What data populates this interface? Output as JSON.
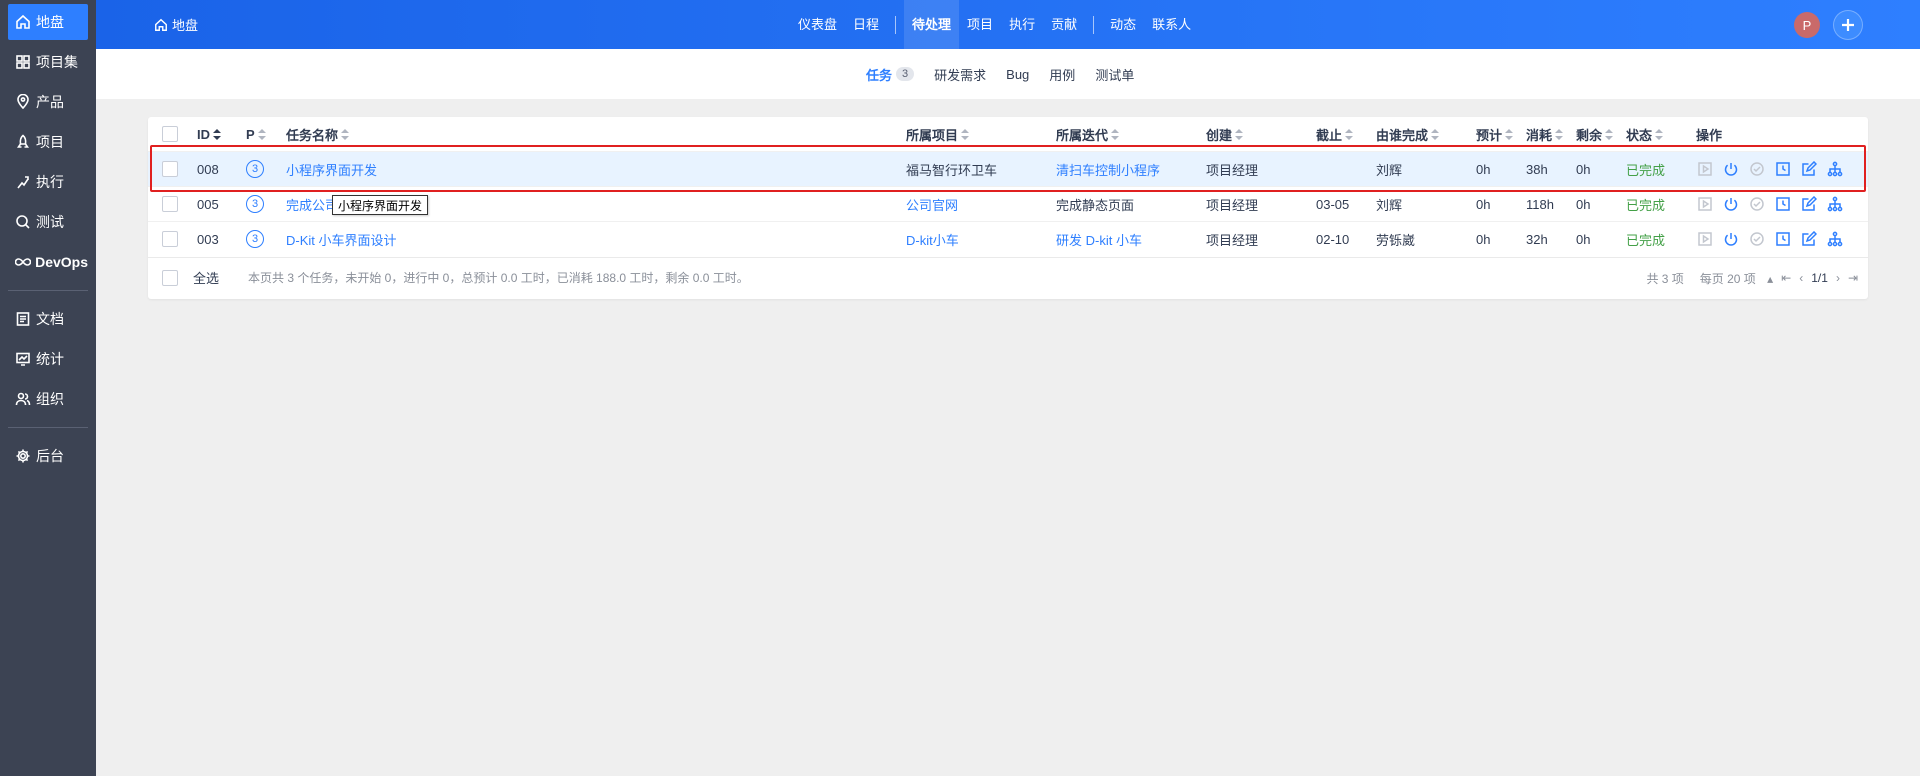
{
  "sidebar": {
    "items": [
      {
        "label": "地盘",
        "icon": "home-icon",
        "active": true
      },
      {
        "label": "项目集",
        "icon": "grid-icon"
      },
      {
        "label": "产品",
        "icon": "map-pin-icon"
      },
      {
        "label": "项目",
        "icon": "rocket-icon"
      },
      {
        "label": "执行",
        "icon": "run-icon"
      },
      {
        "label": "测试",
        "icon": "search-icon"
      },
      {
        "label": "DevOps",
        "icon": "infinity-icon"
      },
      {
        "label": "文档",
        "icon": "document-icon"
      },
      {
        "label": "统计",
        "icon": "chart-icon"
      },
      {
        "label": "组织",
        "icon": "people-icon"
      },
      {
        "label": "后台",
        "icon": "gear-icon"
      }
    ]
  },
  "header": {
    "brand": "地盘",
    "nav": [
      "仪表盘",
      "日程",
      "待处理",
      "项目",
      "执行",
      "贡献",
      "动态",
      "联系人"
    ],
    "avatar": "P"
  },
  "subnav": {
    "tabs": [
      {
        "label": "任务",
        "badge": "3",
        "active": true
      },
      {
        "label": "研发需求"
      },
      {
        "label": "Bug"
      },
      {
        "label": "用例"
      },
      {
        "label": "测试单"
      }
    ]
  },
  "table": {
    "headers": {
      "id": "ID",
      "pri": "P",
      "name": "任务名称",
      "project": "所属项目",
      "execution": "所属迭代",
      "creator": "创建",
      "deadline": "截止",
      "finishedBy": "由谁完成",
      "estimate": "预计",
      "consumed": "消耗",
      "left": "剩余",
      "status": "状态",
      "actions": "操作"
    },
    "rows": [
      {
        "id": "008",
        "pri": "3",
        "name": "小程序界面开发",
        "project": "福马智行环卫车",
        "execution": "清扫车控制小程序",
        "creator": "项目经理",
        "deadline": "",
        "finishedBy": "刘辉",
        "estimate": "0h",
        "consumed": "38h",
        "left": "0h",
        "status": "已完成"
      },
      {
        "id": "005",
        "pri": "3",
        "name": "完成公司官网",
        "project": "公司官网",
        "execution": "完成静态页面",
        "creator": "项目经理",
        "deadline": "03-05",
        "finishedBy": "刘辉",
        "estimate": "0h",
        "consumed": "118h",
        "left": "0h",
        "status": "已完成"
      },
      {
        "id": "003",
        "pri": "3",
        "name": "D-Kit 小车界面设计",
        "project": "D-kit小车",
        "execution": "研发 D-kit 小车",
        "creator": "项目经理",
        "deadline": "02-10",
        "finishedBy": "劳铄崴",
        "estimate": "0h",
        "consumed": "32h",
        "left": "0h",
        "status": "已完成"
      }
    ],
    "footer": {
      "select_all": "全选",
      "summary": "本页共 3 个任务，未开始 0，进行中 0，总预计 0.0 工时，已消耗 188.0 工时，剩余 0.0 工时。",
      "total": "共 3 项",
      "per_page": "每页 20 项",
      "page": "1/1"
    }
  },
  "tooltip": "小程序界面开发",
  "colors": {
    "accent": "#2e7fff",
    "sidebar": "#3c4353",
    "done": "#43a047",
    "highlight": "#e02020"
  }
}
